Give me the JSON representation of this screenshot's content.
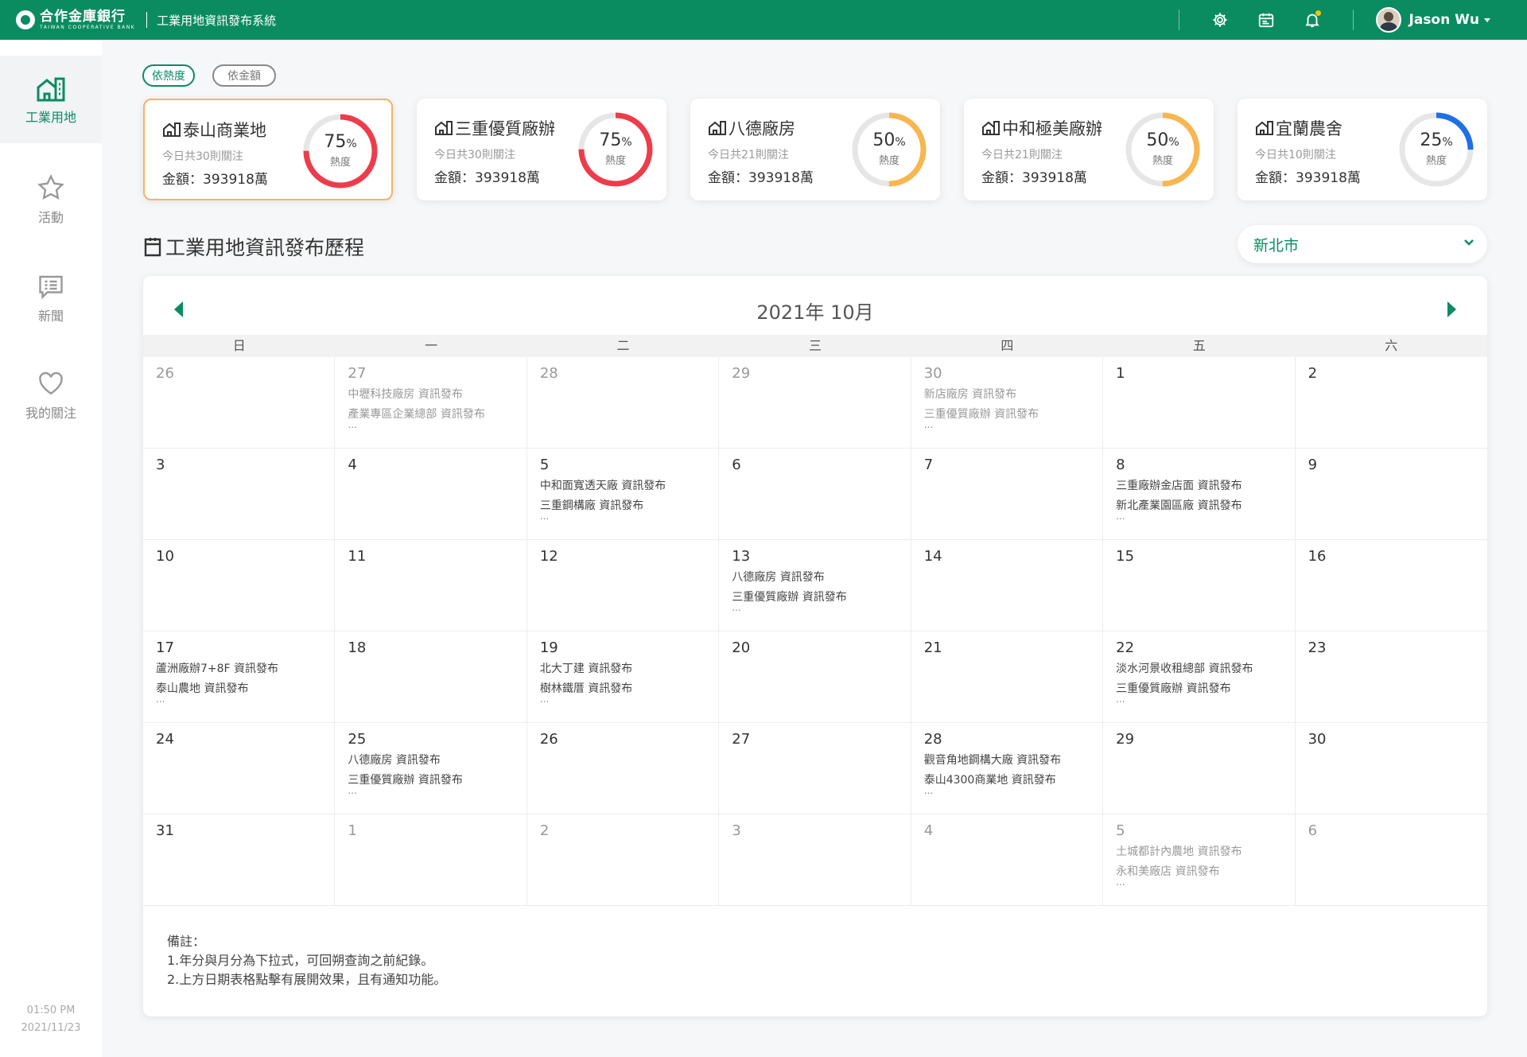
{
  "brand": {
    "name_zh": "合作金庫銀行",
    "name_en": "TAIWAN COOPERATIVE BANK",
    "system_title": "工業用地資訊發布系統"
  },
  "user": {
    "name": "Jason Wu"
  },
  "topbar_icons": [
    "gear-icon",
    "calendar-icon",
    "bell-icon"
  ],
  "sidebar": {
    "items": [
      {
        "label": "工業用地",
        "icon": "building-icon",
        "active": true
      },
      {
        "label": "活動",
        "icon": "star-icon",
        "active": false
      },
      {
        "label": "新聞",
        "icon": "news-icon",
        "active": false
      },
      {
        "label": "我的關注",
        "icon": "heart-icon",
        "active": false
      }
    ],
    "time": "01:50 PM",
    "date": "2021/11/23"
  },
  "filters": [
    {
      "label": "依熱度",
      "active": true
    },
    {
      "label": "依金額",
      "active": false
    }
  ],
  "cards": [
    {
      "title": "泰山商業地",
      "subtitle": "今日共30則關注",
      "amount": "金額：393918萬",
      "percent": 75,
      "percent_label": "75",
      "unit": "%",
      "heat_label": "熱度",
      "color": "#ee3c4b",
      "selected": true
    },
    {
      "title": "三重優質廠辦",
      "subtitle": "今日共30則關注",
      "amount": "金額：393918萬",
      "percent": 75,
      "percent_label": "75",
      "unit": "%",
      "heat_label": "熱度",
      "color": "#ee3c4b",
      "selected": false
    },
    {
      "title": "八德廠房",
      "subtitle": "今日共21則關注",
      "amount": "金額：393918萬",
      "percent": 50,
      "percent_label": "50",
      "unit": "%",
      "heat_label": "熱度",
      "color": "#f7b64f",
      "selected": false
    },
    {
      "title": "中和極美廠辦",
      "subtitle": "今日共21則關注",
      "amount": "金額：393918萬",
      "percent": 50,
      "percent_label": "50",
      "unit": "%",
      "heat_label": "熱度",
      "color": "#f7b64f",
      "selected": false
    },
    {
      "title": "宜蘭農舍",
      "subtitle": "今日共10則關注",
      "amount": "金額：393918萬",
      "percent": 25,
      "percent_label": "25",
      "unit": "%",
      "heat_label": "熱度",
      "color": "#1f6fe5",
      "selected": false
    }
  ],
  "section_title": "工業用地資訊發布歷程",
  "city_select": "新北市",
  "calendar": {
    "title": "2021年 10月",
    "weekdays": [
      "日",
      "一",
      "二",
      "三",
      "四",
      "五",
      "六"
    ],
    "cells": [
      {
        "day": "26",
        "other": true,
        "events": []
      },
      {
        "day": "27",
        "other": true,
        "events": [
          "中壢科技廠房 資訊發布",
          "產業專區企業總部 資訊發布"
        ],
        "more": "..."
      },
      {
        "day": "28",
        "other": true,
        "events": []
      },
      {
        "day": "29",
        "other": true,
        "events": []
      },
      {
        "day": "30",
        "other": true,
        "events": [
          "新店廠房 資訊發布",
          "三重優質廠辦 資訊發布"
        ],
        "more": "..."
      },
      {
        "day": "1",
        "other": false,
        "events": []
      },
      {
        "day": "2",
        "other": false,
        "events": []
      },
      {
        "day": "3",
        "other": false,
        "events": []
      },
      {
        "day": "4",
        "other": false,
        "events": []
      },
      {
        "day": "5",
        "other": false,
        "events": [
          "中和面寬透天廠 資訊發布",
          "三重鋼構廠 資訊發布"
        ],
        "more": "..."
      },
      {
        "day": "6",
        "other": false,
        "events": []
      },
      {
        "day": "7",
        "other": false,
        "events": []
      },
      {
        "day": "8",
        "other": false,
        "events": [
          "三重廠辦金店面 資訊發布",
          "新北產業園區廠 資訊發布"
        ],
        "more": "..."
      },
      {
        "day": "9",
        "other": false,
        "events": []
      },
      {
        "day": "10",
        "other": false,
        "events": []
      },
      {
        "day": "11",
        "other": false,
        "events": []
      },
      {
        "day": "12",
        "other": false,
        "events": []
      },
      {
        "day": "13",
        "other": false,
        "events": [
          "八德廠房 資訊發布",
          "三重優質廠辦 資訊發布"
        ],
        "more": "..."
      },
      {
        "day": "14",
        "other": false,
        "events": []
      },
      {
        "day": "15",
        "other": false,
        "events": []
      },
      {
        "day": "16",
        "other": false,
        "events": []
      },
      {
        "day": "17",
        "other": false,
        "events": [
          "蘆洲廠辦7+8F 資訊發布",
          "泰山農地 資訊發布"
        ],
        "more": "..."
      },
      {
        "day": "18",
        "other": false,
        "events": []
      },
      {
        "day": "19",
        "other": false,
        "events": [
          "北大丁建 資訊發布",
          "樹林鐵厝 資訊發布"
        ],
        "more": "..."
      },
      {
        "day": "20",
        "other": false,
        "events": []
      },
      {
        "day": "21",
        "other": false,
        "events": []
      },
      {
        "day": "22",
        "other": false,
        "events": [
          "淡水河景收租總部 資訊發布",
          "三重優質廠辦 資訊發布"
        ],
        "more": "..."
      },
      {
        "day": "23",
        "other": false,
        "events": []
      },
      {
        "day": "24",
        "other": false,
        "events": []
      },
      {
        "day": "25",
        "other": false,
        "events": [
          "八德廠房 資訊發布",
          "三重優質廠辦 資訊發布"
        ],
        "more": "..."
      },
      {
        "day": "26",
        "other": false,
        "events": []
      },
      {
        "day": "27",
        "other": false,
        "events": []
      },
      {
        "day": "28",
        "other": false,
        "events": [
          "觀音角地鋼構大廠 資訊發布",
          "泰山4300商業地 資訊發布"
        ],
        "more": "..."
      },
      {
        "day": "29",
        "other": false,
        "events": []
      },
      {
        "day": "30",
        "other": false,
        "events": []
      },
      {
        "day": "31",
        "other": false,
        "events": []
      },
      {
        "day": "1",
        "other": true,
        "events": []
      },
      {
        "day": "2",
        "other": true,
        "events": []
      },
      {
        "day": "3",
        "other": true,
        "events": []
      },
      {
        "day": "4",
        "other": true,
        "events": []
      },
      {
        "day": "5",
        "other": true,
        "events": [
          "土城都計內農地 資訊發布",
          "永和美廠店 資訊發布"
        ],
        "more": "..."
      },
      {
        "day": "6",
        "other": true,
        "events": []
      }
    ]
  },
  "notes": {
    "heading": "備註：",
    "lines": [
      "1.年分與月分為下拉式，可回朔查詢之前紀錄。",
      "2.上方日期表格點擊有展開效果，且有通知功能。"
    ]
  },
  "colors": {
    "brand_green": "#0a8c60",
    "selected_border": "#f7b267"
  }
}
